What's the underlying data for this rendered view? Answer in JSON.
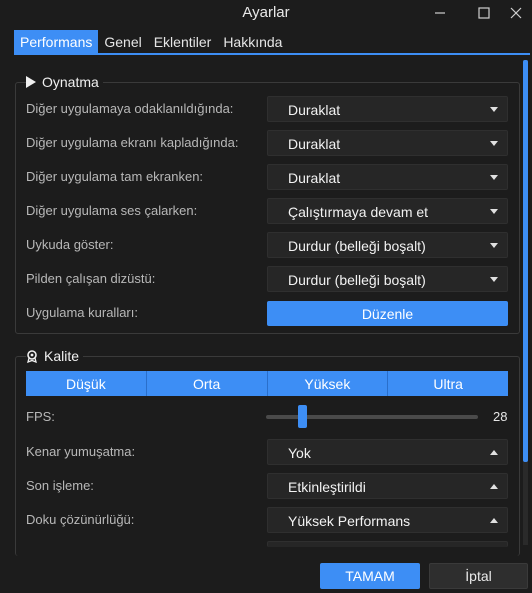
{
  "window": {
    "title": "Ayarlar"
  },
  "tabs": [
    {
      "label": "Performans",
      "active": true
    },
    {
      "label": "Genel",
      "active": false
    },
    {
      "label": "Eklentiler",
      "active": false
    },
    {
      "label": "Hakkında",
      "active": false
    }
  ],
  "playback": {
    "title": "Oynatma",
    "icon": "play-icon",
    "rows": [
      {
        "label": "Diğer uygulamaya odaklanıldığında:",
        "value": "Duraklat"
      },
      {
        "label": "Diğer uygulama ekranı kapladığında:",
        "value": "Duraklat"
      },
      {
        "label": "Diğer uygulama tam ekranken:",
        "value": "Duraklat"
      },
      {
        "label": "Diğer uygulama ses çalarken:",
        "value": "Çalıştırmaya devam et"
      },
      {
        "label": "Uykuda göster:",
        "value": "Durdur (belleği boşalt)"
      },
      {
        "label": "Pilden çalışan dizüstü:",
        "value": "Durdur (belleği boşalt)"
      }
    ],
    "rules": {
      "label": "Uygulama kuralları:",
      "button": "Düzenle"
    }
  },
  "quality": {
    "title": "Kalite",
    "icon": "badge-icon",
    "presets": [
      "Düşük",
      "Orta",
      "Yüksek",
      "Ultra"
    ],
    "fps": {
      "label": "FPS:",
      "value": "28",
      "level": 0.18
    },
    "antialias": {
      "label": "Kenar yumuşatma:",
      "value": "Yok"
    },
    "postprocess": {
      "label": "Son işleme:",
      "value": "Etkinleştirildi"
    },
    "texture": {
      "label": "Doku çözünürlüğü:",
      "value": "Yüksek Performans"
    }
  },
  "footer": {
    "ok": "TAMAM",
    "cancel": "İptal"
  },
  "colors": {
    "accent": "#3d8ef5",
    "background": "#1c1c1c"
  }
}
